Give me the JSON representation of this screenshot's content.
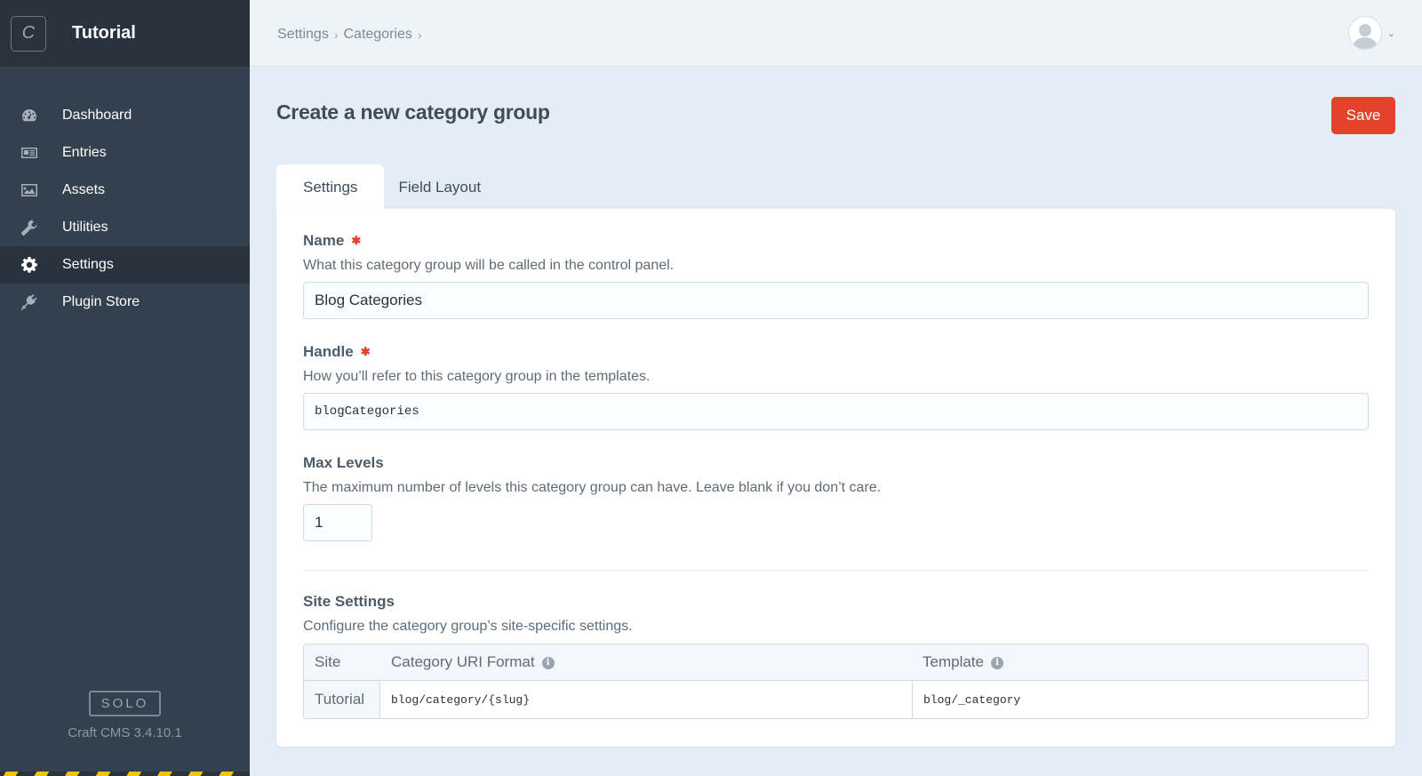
{
  "sidebar": {
    "logo_letter": "C",
    "site_name": "Tutorial",
    "items": [
      {
        "label": "Dashboard",
        "icon": "dashboard-icon"
      },
      {
        "label": "Entries",
        "icon": "entries-icon"
      },
      {
        "label": "Assets",
        "icon": "assets-icon"
      },
      {
        "label": "Utilities",
        "icon": "wrench-icon"
      },
      {
        "label": "Settings",
        "icon": "gear-icon",
        "active": true
      },
      {
        "label": "Plugin Store",
        "icon": "plug-icon"
      }
    ],
    "edition": "SOLO",
    "version": "Craft CMS 3.4.10.1"
  },
  "header": {
    "breadcrumbs": [
      "Settings",
      "Categories"
    ],
    "separator": "›",
    "account_caret": "⌄"
  },
  "main": {
    "title": "Create a new category group",
    "save_label": "Save",
    "tabs": [
      {
        "label": "Settings",
        "active": true
      },
      {
        "label": "Field Layout",
        "active": false
      }
    ],
    "fields": {
      "name": {
        "label": "Name",
        "required": "✱",
        "instructions": "What this category group will be called in the control panel.",
        "value": "Blog Categories"
      },
      "handle": {
        "label": "Handle",
        "required": "✱",
        "instructions": "How you’ll refer to this category group in the templates.",
        "value": "blogCategories"
      },
      "max_levels": {
        "label": "Max Levels",
        "instructions": "The maximum number of levels this category group can have. Leave blank if you don’t care.",
        "value": "1"
      }
    },
    "site_settings": {
      "label": "Site Settings",
      "instructions": "Configure the category group’s site-specific settings.",
      "columns": [
        "Site",
        "Category URI Format",
        "Template"
      ],
      "info_glyph": "i",
      "rows": [
        {
          "site": "Tutorial",
          "uri_format": "blog/category/{slug}",
          "template": "blog/_category"
        }
      ]
    }
  },
  "colors": {
    "accent": "#e5422b",
    "sidebar": "#33404d",
    "sidebar_dark": "#29323d",
    "page_bg": "#e4edf6"
  }
}
